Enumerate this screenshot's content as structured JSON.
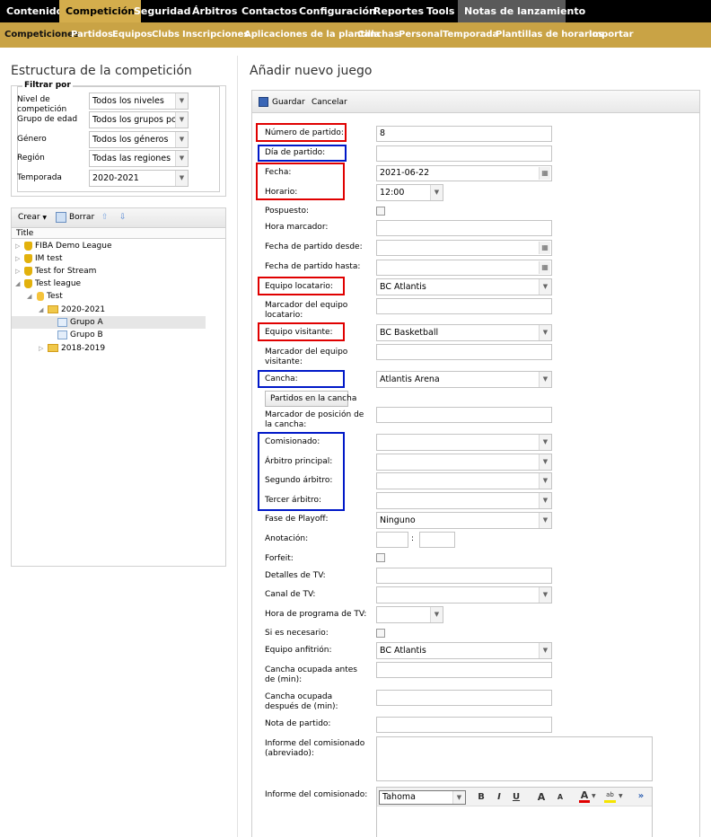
{
  "top_nav": {
    "items": [
      {
        "label": "Contenido"
      },
      {
        "label": "Competición"
      },
      {
        "label": "Seguridad"
      },
      {
        "label": "Árbitros"
      },
      {
        "label": "Contactos"
      },
      {
        "label": "Configuración"
      },
      {
        "label": "Reportes"
      },
      {
        "label": "Tools"
      },
      {
        "label": "Notas de lanzamiento"
      }
    ],
    "active": "Competición"
  },
  "sub_nav": {
    "items": [
      {
        "label": "Competiciones"
      },
      {
        "label": "Partidos"
      },
      {
        "label": "Equipos"
      },
      {
        "label": "Clubs"
      },
      {
        "label": "Inscripciones"
      },
      {
        "label": "Aplicaciones de la plantilla"
      },
      {
        "label": "Canchas"
      },
      {
        "label": "Personal"
      },
      {
        "label": "Temporada"
      },
      {
        "label": "Plantillas de horarios"
      },
      {
        "label": "Importar"
      }
    ],
    "active": "Competiciones"
  },
  "left": {
    "title": "Estructura de la competición",
    "filter_legend": "Filtrar por",
    "filters": [
      {
        "label": "Nivel de competición",
        "value": "Todos los niveles"
      },
      {
        "label": "Grupo de edad",
        "value": "Todos los grupos por"
      },
      {
        "label": "Género",
        "value": "Todos los géneros"
      },
      {
        "label": "Región",
        "value": "Todas las regiones"
      },
      {
        "label": "Temporada",
        "value": "2020-2021"
      }
    ],
    "toolbar": {
      "create": "Crear",
      "delete": "Borrar"
    },
    "tree_header": "Title",
    "tree": [
      {
        "label": "FIBA Demo League"
      },
      {
        "label": "IM test"
      },
      {
        "label": "Test for Stream"
      },
      {
        "label": "Test league"
      },
      {
        "label": "Test"
      },
      {
        "label": "2020-2021"
      },
      {
        "label": "Grupo A"
      },
      {
        "label": "Grupo B"
      },
      {
        "label": "2018-2019"
      }
    ]
  },
  "right": {
    "title": "Añadir nuevo juego",
    "toolbar": {
      "save": "Guardar",
      "cancel": "Cancelar"
    },
    "fields": {
      "numero": {
        "label": "Número de partido:",
        "value": "8"
      },
      "dia": {
        "label": "Día de partido:",
        "value": ""
      },
      "fecha": {
        "label": "Fecha:",
        "value": "2021-06-22"
      },
      "horario": {
        "label": "Horario:",
        "value": "12:00"
      },
      "pospuesto": {
        "label": "Pospuesto:"
      },
      "hora_marcador": {
        "label": "Hora marcador:"
      },
      "fecha_desde": {
        "label": "Fecha de partido desde:"
      },
      "fecha_hasta": {
        "label": "Fecha de partido hasta:"
      },
      "local": {
        "label": "Equipo locatario:",
        "value": "BC Atlantis"
      },
      "marcador_local": {
        "label": "Marcador del equipo locatario:"
      },
      "visitante": {
        "label": "Equipo visitante:",
        "value": "BC Basketball"
      },
      "marcador_visitante": {
        "label": "Marcador del equipo visitante:"
      },
      "cancha": {
        "label": "Cancha:",
        "value": "Atlantis Arena"
      },
      "partidos_cancha_btn": "Partidos en la cancha",
      "marcador_posicion": {
        "label": "Marcador de posición de la cancha:"
      },
      "comisionado": {
        "label": "Comisionado:"
      },
      "arbitro_principal": {
        "label": "Árbitro principal:"
      },
      "segundo_arbitro": {
        "label": "Segundo árbitro:"
      },
      "tercer_arbitro": {
        "label": "Tercer árbitro:"
      },
      "fase_playoff": {
        "label": "Fase de Playoff:",
        "value": "Ninguno"
      },
      "anotacion": {
        "label": "Anotación:",
        "sep": ":"
      },
      "forfeit": {
        "label": "Forfeit:"
      },
      "detalles_tv": {
        "label": "Detalles de TV:"
      },
      "canal_tv": {
        "label": "Canal de TV:"
      },
      "hora_tv": {
        "label": "Hora de programa de TV:"
      },
      "si_necesario": {
        "label": "Si es necesario:"
      },
      "anfitrion": {
        "label": "Equipo anfitrión:",
        "value": "BC Atlantis"
      },
      "ocupada_antes": {
        "label": "Cancha ocupada antes de (min):"
      },
      "ocupada_despues": {
        "label": "Cancha ocupada después de (min):"
      },
      "nota": {
        "label": "Nota de partido:"
      },
      "informe_abreviado": {
        "label": "Informe del comisionado (abreviado):"
      },
      "informe": {
        "label": "Informe del comisionado:"
      }
    },
    "editor": {
      "font": "Tahoma",
      "bold": "B",
      "italic": "I",
      "underline": "U",
      "grow": "A",
      "shrink": "A",
      "more": "»"
    }
  },
  "colors": {
    "highlight_red": "#e00000",
    "highlight_blue": "#0018c8",
    "nav_gold": "#c9a345"
  }
}
